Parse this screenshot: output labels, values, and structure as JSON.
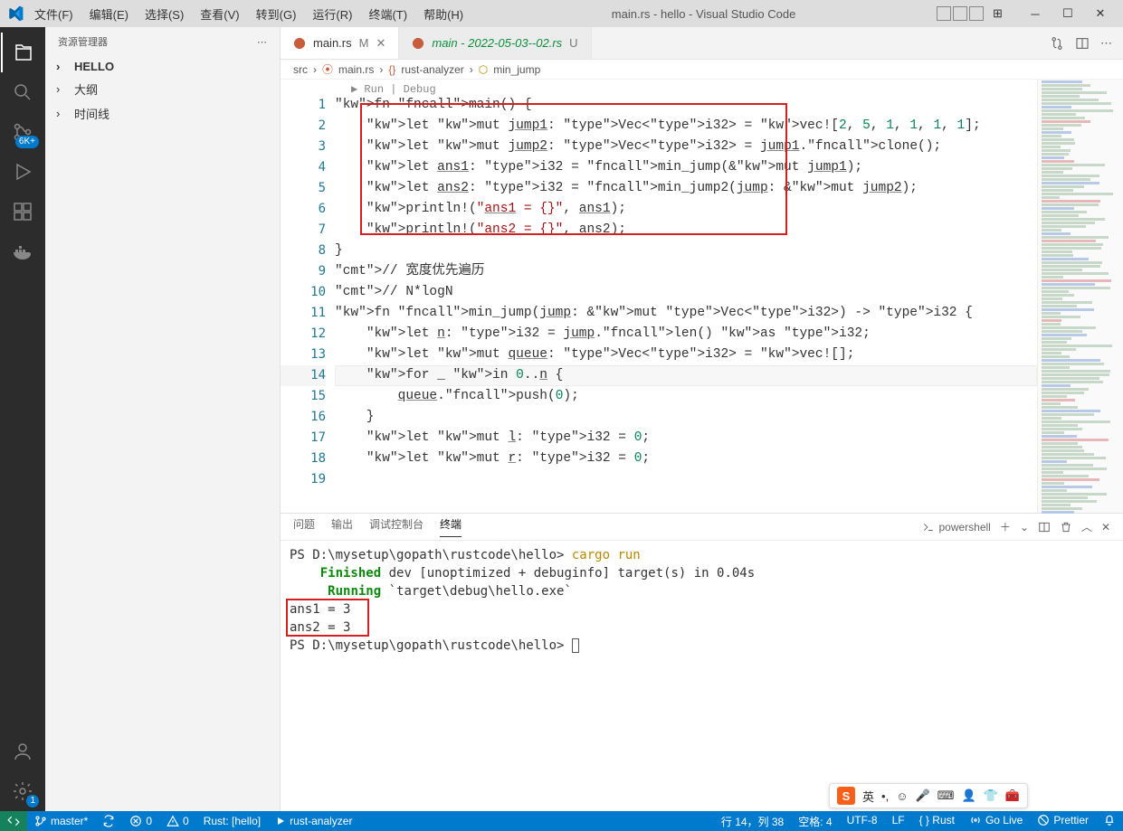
{
  "titlebar": {
    "menu": [
      "文件(F)",
      "编辑(E)",
      "选择(S)",
      "查看(V)",
      "转到(G)",
      "运行(R)",
      "终端(T)",
      "帮助(H)"
    ],
    "title": "main.rs - hello - Visual Studio Code"
  },
  "activitybar": {
    "badges": {
      "scm": "6K+",
      "settings": "1"
    }
  },
  "sidebar": {
    "title": "资源管理器",
    "items": [
      {
        "label": "HELLO",
        "bold": true
      },
      {
        "label": "大纲"
      },
      {
        "label": "时间线"
      }
    ]
  },
  "tabs": [
    {
      "icon": "rust",
      "label": "main.rs",
      "suffix": "M",
      "active": true,
      "closable": true
    },
    {
      "icon": "rust",
      "label": "main - 2022-05-03--02.rs",
      "suffix": "U",
      "italic": true
    }
  ],
  "breadcrumb": [
    "src",
    "main.rs",
    "rust-analyzer",
    "min_jump"
  ],
  "codelens": "▶ Run | Debug",
  "code_lines_start": 1,
  "code": [
    "fn main() {",
    "    let mut jump1: Vec<i32> = vec![2, 5, 1, 1, 1, 1];",
    "    let mut jump2: Vec<i32> = jump1.clone();",
    "    let ans1: i32 = min_jump(&mut jump1);",
    "    let ans2: i32 = min_jump2(jump: &mut jump2);",
    "    println!(\"ans1 = {}\", ans1);",
    "    println!(\"ans2 = {}\", ans2);",
    "}",
    "",
    "// 宽度优先遍历",
    "// N*logN",
    "fn min_jump(jump: &mut Vec<i32>) -> i32 {",
    "    let n: i32 = jump.len() as i32;",
    "    let mut queue: Vec<i32> = vec![];",
    "    for _ in 0..n {",
    "        queue.push(0);",
    "    }",
    "    let mut l: i32 = 0;",
    "    let mut r: i32 = 0;"
  ],
  "current_line_number": 14,
  "panel": {
    "tabs": [
      "问题",
      "输出",
      "调试控制台",
      "终端"
    ],
    "active_tab": "终端",
    "shell_label": "powershell",
    "terminal": [
      {
        "t": "plain",
        "s": "PS D:\\mysetup\\gopath\\rustcode\\hello> "
      },
      {
        "t": "y",
        "s": "cargo run"
      },
      {
        "t": "nl"
      },
      {
        "t": "plain",
        "s": "    "
      },
      {
        "t": "g",
        "s": "Finished"
      },
      {
        "t": "plain",
        "s": " dev [unoptimized + debuginfo] target(s) in 0.04s"
      },
      {
        "t": "nl"
      },
      {
        "t": "plain",
        "s": "     "
      },
      {
        "t": "g",
        "s": "Running"
      },
      {
        "t": "plain",
        "s": " `target\\debug\\hello.exe`"
      },
      {
        "t": "nl"
      },
      {
        "t": "plain",
        "s": "ans1 = 3"
      },
      {
        "t": "nl"
      },
      {
        "t": "plain",
        "s": "ans2 = 3"
      },
      {
        "t": "nl"
      },
      {
        "t": "plain",
        "s": "PS D:\\mysetup\\gopath\\rustcode\\hello> "
      },
      {
        "t": "cursor"
      }
    ]
  },
  "ime": {
    "mode": "英"
  },
  "statusbar": {
    "left": [
      {
        "icon": "remote",
        "label": ""
      },
      {
        "icon": "branch",
        "label": "master*"
      },
      {
        "icon": "sync",
        "label": ""
      },
      {
        "icon": "err",
        "label": "0"
      },
      {
        "icon": "warn",
        "label": "0"
      },
      {
        "label": "Rust: [hello]"
      },
      {
        "icon": "play",
        "label": "rust-analyzer"
      }
    ],
    "right": [
      {
        "label": "行 14，列 38"
      },
      {
        "label": "空格: 4"
      },
      {
        "label": "UTF-8"
      },
      {
        "label": "LF"
      },
      {
        "label": "{ } Rust"
      },
      {
        "icon": "radio",
        "label": "Go Live"
      },
      {
        "icon": "ban",
        "label": "Prettier"
      },
      {
        "icon": "bell",
        "label": ""
      }
    ]
  }
}
